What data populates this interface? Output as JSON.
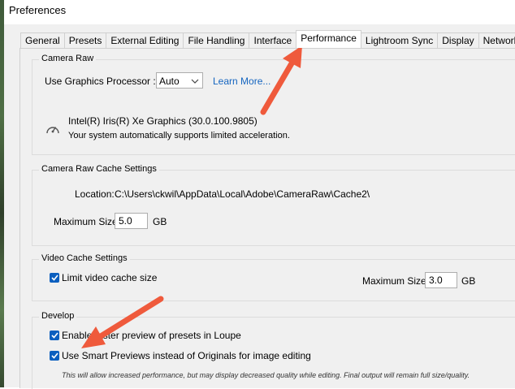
{
  "window": {
    "title": "Preferences"
  },
  "tabs": [
    {
      "label": "General"
    },
    {
      "label": "Presets"
    },
    {
      "label": "External Editing"
    },
    {
      "label": "File Handling"
    },
    {
      "label": "Interface"
    },
    {
      "label": "Performance",
      "active": true
    },
    {
      "label": "Lightroom Sync"
    },
    {
      "label": "Display"
    },
    {
      "label": "Network"
    }
  ],
  "camera_raw": {
    "legend": "Camera Raw",
    "gpu_label": "Use Graphics Processor :",
    "gpu_value": "Auto",
    "learn_more": "Learn More...",
    "gpu_name": "Intel(R) Iris(R) Xe Graphics (30.0.100.9805)",
    "gpu_status": "Your system automatically supports limited acceleration.",
    "gpu_icon": "gauge-icon"
  },
  "cache_settings": {
    "legend": "Camera Raw Cache Settings",
    "location_label": "Location:",
    "location_value": "C:\\Users\\ckwil\\AppData\\Local\\Adobe\\CameraRaw\\Cache2\\",
    "max_size_label": "Maximum Size:",
    "max_size_value": "5.0",
    "unit": "GB"
  },
  "video_cache": {
    "legend": "Video Cache Settings",
    "limit_label": "Limit video cache size",
    "limit_checked": true,
    "max_size_label": "Maximum Size:",
    "max_size_value": "3.0",
    "unit": "GB"
  },
  "develop": {
    "legend": "Develop",
    "option1_label": "Enable faster preview of presets in Loupe",
    "option1_checked": true,
    "option2_label": "Use Smart Previews instead of Originals for image editing",
    "option2_checked": true,
    "note": "This will allow increased performance, but may display decreased quality while editing. Final output will remain full size/quality."
  },
  "colors": {
    "accent": "#0b5fbf",
    "annotation_arrow": "#ef5a3c",
    "link": "#1565c0"
  }
}
